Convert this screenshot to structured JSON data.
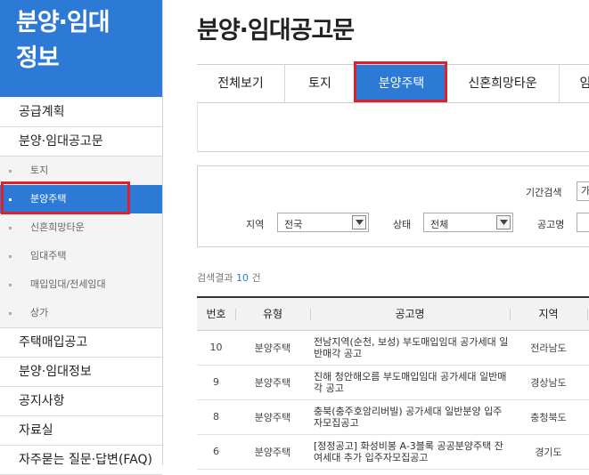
{
  "sidebar": {
    "title": "분양·임대\n정보",
    "items": [
      {
        "label": "공급계획"
      },
      {
        "label": "분양·임대공고문"
      },
      {
        "label": "토지"
      },
      {
        "label": "분양주택"
      },
      {
        "label": "신혼희망타운"
      },
      {
        "label": "임대주택"
      },
      {
        "label": "매입임대/전세임대"
      },
      {
        "label": "상가"
      },
      {
        "label": "주택매입공고"
      },
      {
        "label": "분양·임대정보"
      },
      {
        "label": "공지사항"
      },
      {
        "label": "자료실"
      },
      {
        "label": "자주묻는 질문·답변(FAQ)"
      }
    ]
  },
  "main": {
    "page_title": "분양·임대공고문",
    "tabs": [
      {
        "label": "전체보기"
      },
      {
        "label": "토지"
      },
      {
        "label": "분양주택"
      },
      {
        "label": "신혼희망타운"
      },
      {
        "label": "임"
      }
    ]
  },
  "search": {
    "period_label": "기간검색",
    "period_value": "가",
    "region_label": "지역",
    "region_value": "전국",
    "status_label": "상태",
    "status_value": "전체",
    "notice_label": "공고명"
  },
  "result": {
    "prefix": "검색결과",
    "count": "10",
    "suffix": "건"
  },
  "table": {
    "headers": [
      "번호",
      "유형",
      "공고명",
      "지역"
    ],
    "rows": [
      {
        "no": "10",
        "type": "분양주택",
        "title": "전남지역(순천, 보성) 부도매입임대 공가세대 일반매각 공고",
        "region": "전라남도"
      },
      {
        "no": "9",
        "type": "분양주택",
        "title": "진해 청안해오름 부도매입임대 공가세대 일반매각 공고",
        "region": "경상남도"
      },
      {
        "no": "8",
        "type": "분양주택",
        "title": "충북(충주호암리버빌) 공가세대 일반분양 입주자모집공고",
        "region": "충청북도"
      },
      {
        "no": "6",
        "type": "분양주택",
        "title": "[정정공고] 화성비봉 A-3블록 공공분양주택 잔여세대 추가 입주자모집공고",
        "region": "경기도"
      }
    ]
  },
  "colors": {
    "accent": "#2d7ad6",
    "highlight": "#e0202a"
  }
}
